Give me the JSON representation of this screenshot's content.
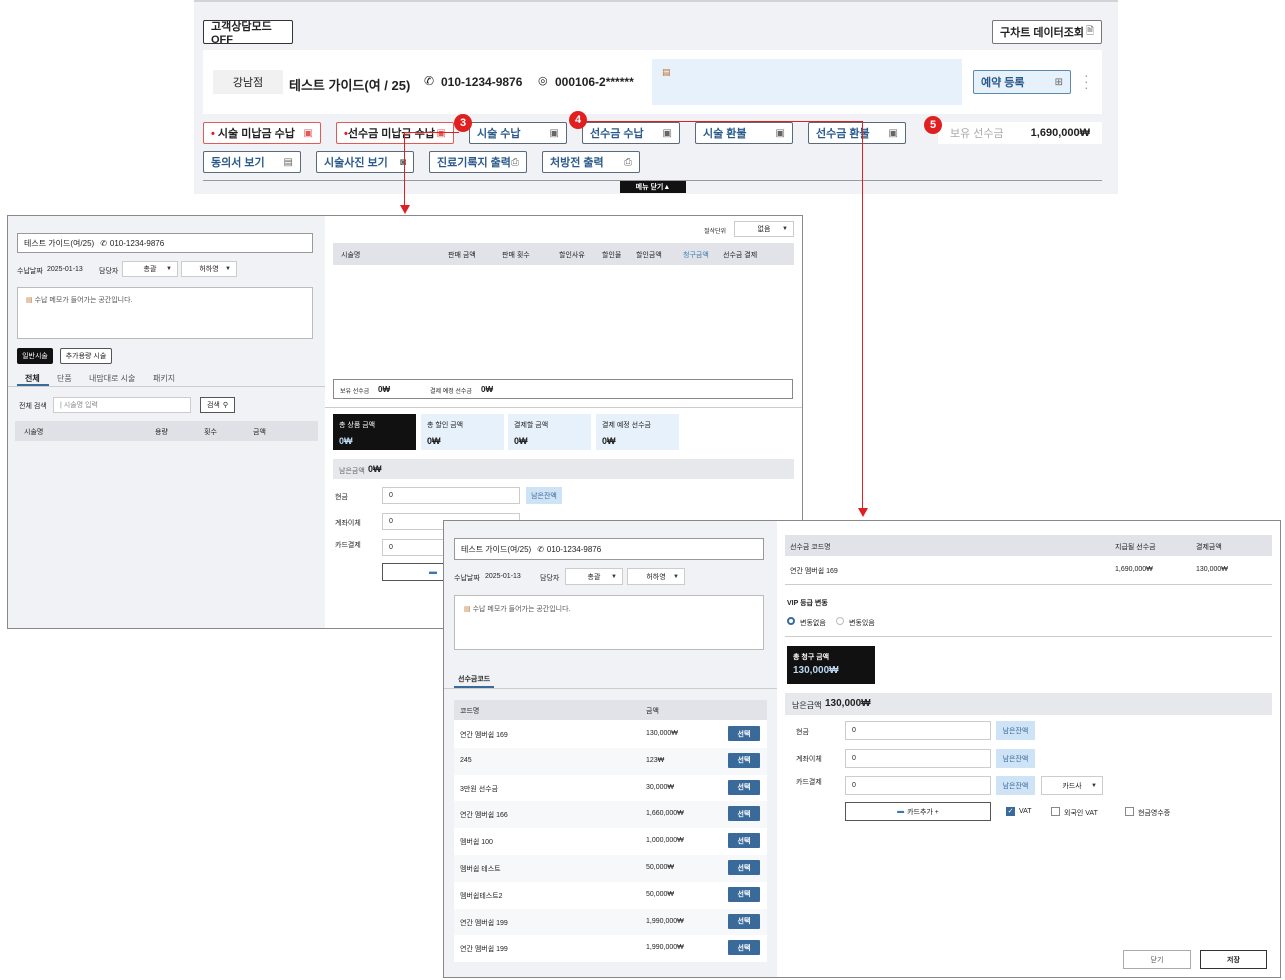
{
  "top_panel": {
    "consult_mode": "고객상담모드 OFF",
    "old_chart": "구차트 데이터조회",
    "branch": "강남점",
    "patient": "테스트 가이드(여 / 25)",
    "phone": "010-1234-9876",
    "id_no": "000106-2******",
    "reserve": "예약 등록",
    "actions_row1": [
      "시술 미납금 수납",
      "선수금 미납금 수납",
      "시술 수납",
      "선수금 수납",
      "시술 환불",
      "선수금 환불"
    ],
    "prepaid_label": "보유 선수금",
    "prepaid_value": "1,690,000₩",
    "actions_row2": [
      "동의서 보기",
      "시술사진 보기",
      "진료기록지 출력",
      "처방전 출력"
    ],
    "menu_close": "메뉴 닫기▲"
  },
  "badges": [
    "3",
    "4",
    "5"
  ],
  "panel_a": {
    "patient": "테스트 가이드(여/25)",
    "phone": "010-1234-9876",
    "date_label": "수납날짜",
    "date": "2025-01-13",
    "manager_label": "담당자",
    "manager_sel1": "총괄",
    "manager_sel2": "허하영",
    "memo": "수납 메모가 들어가는 공간입니다.",
    "tab_general": "일반시술",
    "tab_extra": "추가용량 시술",
    "subtabs": [
      "전체",
      "단품",
      "내맘대로 시술",
      "패키지"
    ],
    "search_label": "전체 검색",
    "search_placeholder": "| 시술명 입력",
    "search_btn": "검색",
    "list_headers": [
      "시술명",
      "용량",
      "횟수",
      "금액"
    ],
    "unit_label": "절삭단위",
    "unit_value": "없음",
    "table_headers": [
      "시술명",
      "판매 금액",
      "판매 횟수",
      "할인사유",
      "할인율",
      "할인금액",
      "청구금액",
      "선수금 결제"
    ],
    "prepaid_have_label": "보유 선수금",
    "prepaid_have_value": "0₩",
    "prepaid_plan_label": "결제 예정 선수금",
    "prepaid_plan_value": "0₩",
    "cards": [
      {
        "label": "총 상품 금액",
        "value": "0₩"
      },
      {
        "label": "총 할인 금액",
        "value": "0₩"
      },
      {
        "label": "결제할 금액",
        "value": "0₩"
      },
      {
        "label": "결제 예정 선수금",
        "value": "0₩"
      }
    ],
    "remain_label": "남은금액",
    "remain_value": "0₩",
    "pay_rows": [
      "현금",
      "계좌이체",
      "카드결제"
    ],
    "pay_value": "0",
    "remain_btn": "남은잔액"
  },
  "panel_b": {
    "patient": "테스트 가이드(여/25)",
    "phone": "010-1234-9876",
    "date_label": "수납날짜",
    "date": "2025-01-13",
    "manager_label": "담당자",
    "manager_sel1": "총괄",
    "manager_sel2": "허하영",
    "memo": "수납 메모가 들어가는 공간입니다.",
    "code_tab": "선수금코드",
    "code_headers": [
      "코드명",
      "금액"
    ],
    "codes": [
      {
        "name": "연간 멤버쉽 169",
        "amount": "130,000₩"
      },
      {
        "name": "245",
        "amount": "123₩"
      },
      {
        "name": "3만원 선수금",
        "amount": "30,000₩"
      },
      {
        "name": "연간 멤버쉽 166",
        "amount": "1,660,000₩"
      },
      {
        "name": "멤버쉽 100",
        "amount": "1,000,000₩"
      },
      {
        "name": "멤버쉽 테스트",
        "amount": "50,000₩"
      },
      {
        "name": "멤버쉽테스트2",
        "amount": "50,000₩"
      },
      {
        "name": "연간 멤버쉽 199",
        "amount": "1,990,000₩"
      },
      {
        "name": "연간 멤버쉽 199",
        "amount": "1,990,000₩"
      }
    ],
    "select_btn": "선택",
    "right_headers": [
      "선수금 코드명",
      "지급될 선수금",
      "결제금액"
    ],
    "right_row": {
      "name": "연간 멤버쉽 169",
      "give": "1,690,000₩",
      "pay": "130,000₩"
    },
    "vip_label": "VIP 등급 변동",
    "vip_opt1": "변동없음",
    "vip_opt2": "변동있음",
    "total_label": "총 청구 금액",
    "total_value": "130,000₩",
    "remain_label": "남은금액",
    "remain_value": "130,000₩",
    "pay_rows": [
      "현금",
      "계좌이체",
      "카드결제"
    ],
    "pay_value": "0",
    "remain_btn": "남은잔액",
    "card_company": "카드사",
    "card_add": "카드추가 +",
    "vat": "VAT",
    "foreign_vat": "외국인 VAT",
    "cash_receipt": "현금영수증",
    "close_btn": "닫기",
    "save_btn": "저장"
  }
}
